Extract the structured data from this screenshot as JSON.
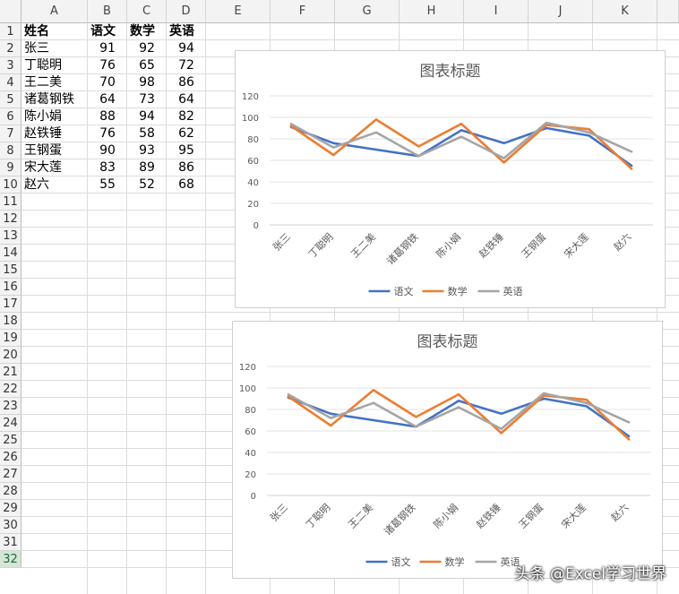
{
  "sheet": {
    "columns": [
      "A",
      "B",
      "C",
      "D",
      "E",
      "F",
      "G",
      "H",
      "I",
      "J",
      "K"
    ],
    "rows": [
      "1",
      "2",
      "3",
      "4",
      "5",
      "6",
      "7",
      "8",
      "9",
      "10",
      "11",
      "12",
      "13",
      "14",
      "15",
      "16",
      "17",
      "18",
      "19",
      "20",
      "21",
      "22",
      "23",
      "24",
      "25",
      "26",
      "27",
      "28",
      "29",
      "30",
      "31",
      "32"
    ],
    "selected_row": "32",
    "headers": [
      "姓名",
      "语文",
      "数学",
      "英语"
    ],
    "records": [
      [
        "张三",
        "91",
        "92",
        "94"
      ],
      [
        "丁聪明",
        "76",
        "65",
        "72"
      ],
      [
        "王二美",
        "70",
        "98",
        "86"
      ],
      [
        "诸葛钢铁",
        "64",
        "73",
        "64"
      ],
      [
        "陈小娟",
        "88",
        "94",
        "82"
      ],
      [
        "赵铁锤",
        "76",
        "58",
        "62"
      ],
      [
        "王钢蛋",
        "90",
        "93",
        "95"
      ],
      [
        "宋大莲",
        "83",
        "89",
        "86"
      ],
      [
        "赵六",
        "55",
        "52",
        "68"
      ]
    ]
  },
  "chart_data": [
    {
      "type": "line",
      "title": "图表标题",
      "categories": [
        "张三",
        "丁聪明",
        "王二美",
        "诸葛钢铁",
        "陈小娟",
        "赵铁锤",
        "王钢蛋",
        "宋大莲",
        "赵六"
      ],
      "series": [
        {
          "name": "语文",
          "values": [
            91,
            76,
            70,
            64,
            88,
            76,
            90,
            83,
            55
          ],
          "color": "#4472c4"
        },
        {
          "name": "数学",
          "values": [
            92,
            65,
            98,
            73,
            94,
            58,
            93,
            89,
            52
          ],
          "color": "#ed7d31"
        },
        {
          "name": "英语",
          "values": [
            94,
            72,
            86,
            64,
            82,
            62,
            95,
            86,
            68
          ],
          "color": "#a5a5a5"
        }
      ],
      "ylim": [
        0,
        120
      ],
      "yticks": [
        "0",
        "20",
        "40",
        "60",
        "80",
        "100",
        "120"
      ],
      "grid": true,
      "legend": "bottom"
    },
    {
      "type": "line",
      "title": "图表标题",
      "categories": [
        "张三",
        "丁聪明",
        "王二美",
        "诸葛钢铁",
        "陈小娟",
        "赵铁锤",
        "王钢蛋",
        "宋大莲",
        "赵六"
      ],
      "series": [
        {
          "name": "语文",
          "values": [
            91,
            76,
            70,
            64,
            88,
            76,
            90,
            83,
            55
          ],
          "color": "#4472c4"
        },
        {
          "name": "数学",
          "values": [
            92,
            65,
            98,
            73,
            94,
            58,
            93,
            89,
            52
          ],
          "color": "#ed7d31"
        },
        {
          "name": "英语",
          "values": [
            94,
            72,
            86,
            64,
            82,
            62,
            95,
            86,
            68
          ],
          "color": "#a5a5a5"
        }
      ],
      "ylim": [
        0,
        120
      ],
      "yticks": [
        "0",
        "20",
        "40",
        "60",
        "80",
        "100",
        "120"
      ],
      "grid": true,
      "legend": "bottom"
    }
  ],
  "watermark": "头条 @Excel学习世界"
}
